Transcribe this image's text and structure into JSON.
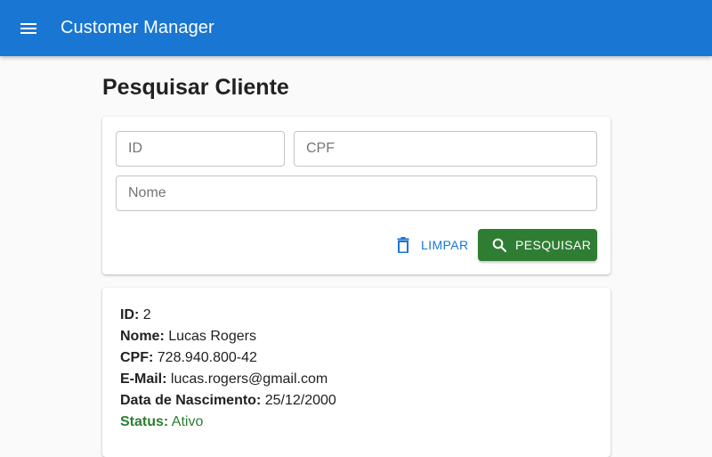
{
  "app": {
    "title": "Customer Manager"
  },
  "page": {
    "title": "Pesquisar Cliente"
  },
  "search": {
    "id_placeholder": "ID",
    "cpf_placeholder": "CPF",
    "nome_placeholder": "Nome",
    "id_value": "",
    "cpf_value": "",
    "nome_value": "",
    "clear_label": "LIMPAR",
    "search_label": "PESQUISAR"
  },
  "result": {
    "id_label": "ID:",
    "id_value": "2",
    "nome_label": "Nome:",
    "nome_value": "Lucas Rogers",
    "cpf_label": "CPF:",
    "cpf_value": "728.940.800-42",
    "email_label": "E-Mail:",
    "email_value": "lucas.rogers@gmail.com",
    "nascimento_label": "Data de Nascimento:",
    "nascimento_value": "25/12/2000",
    "status_label": "Status:",
    "status_value": "Ativo"
  },
  "icons": {
    "menu": "menu-icon",
    "clear": "trash-icon",
    "search": "search-icon"
  },
  "colors": {
    "appbar": "#1976d2",
    "primary": "#1976d2",
    "success": "#2e7d32"
  }
}
